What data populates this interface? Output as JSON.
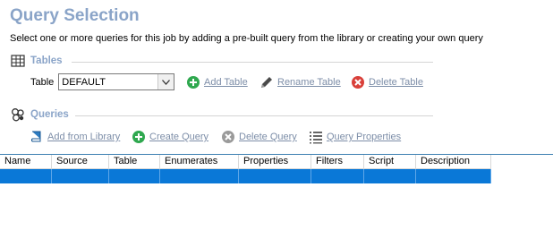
{
  "header": {
    "title": "Query Selection",
    "subtitle": "Select one or more queries for this job by adding a pre-built query from the library or creating your own query"
  },
  "tables_section": {
    "heading": "Tables",
    "table_label": "Table",
    "table_value": "DEFAULT",
    "actions": {
      "add": "Add Table",
      "rename": "Rename Table",
      "delete": "Delete Table"
    }
  },
  "queries_section": {
    "heading": "Queries",
    "actions": {
      "add_library": "Add from Library",
      "create": "Create Query",
      "delete": "Delete Query",
      "properties": "Query Properties"
    }
  },
  "grid": {
    "columns": [
      "Name",
      "Source",
      "Table",
      "Enumerates",
      "Properties",
      "Filters",
      "Script",
      "Description"
    ]
  },
  "colors": {
    "title": "#8aa4c8",
    "selection": "#0a78d7",
    "add_green": "#2fa84f",
    "delete_red": "#d9403a"
  }
}
